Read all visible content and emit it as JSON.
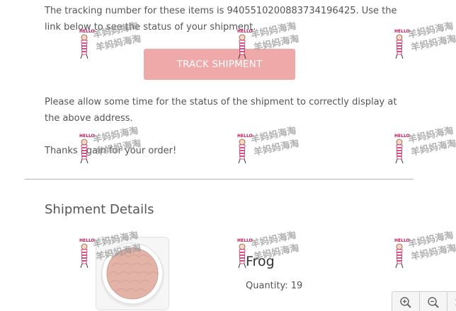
{
  "email": {
    "tracking_paragraph": "The tracking number for these items is 9405510200883734196425. Use the link below to see the status of your shipment.",
    "track_button_label": "TRACK SHIPMENT",
    "status_note": "Please allow some time for the status of the shipment to correctly display at the above address.",
    "thanks": "Thanks again for your order!",
    "section_title": "Shipment Details",
    "product": {
      "name": "Frog",
      "quantity_label": "Quantity:",
      "quantity": "19"
    }
  },
  "watermark": {
    "line1": "羊妈妈海淘",
    "line2": "羊妈妈海淘",
    "badge": "HELLO"
  },
  "zoom": {
    "level": "1"
  },
  "colors": {
    "button_bg": "#f0a9a9",
    "text": "#555555",
    "divider": "#b5b5b5"
  }
}
